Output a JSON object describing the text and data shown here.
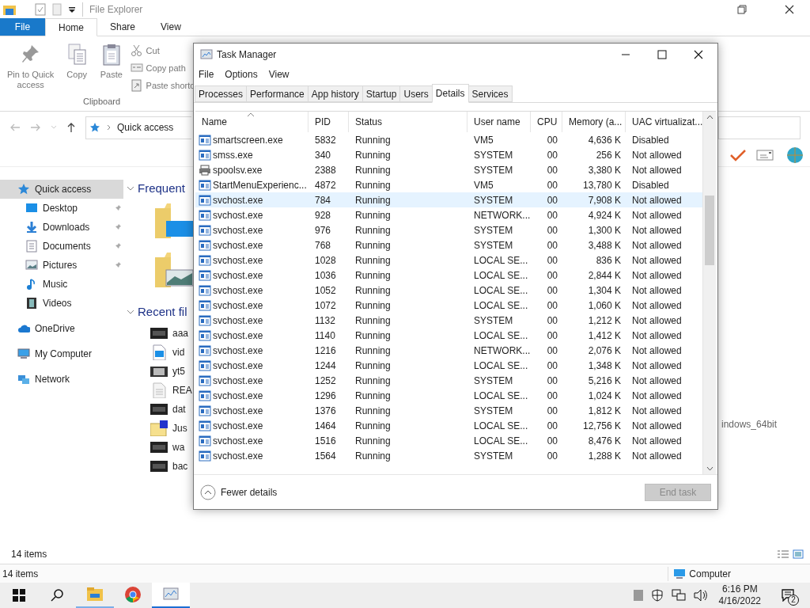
{
  "explorer": {
    "title": "File Explorer",
    "ribbon_tabs": [
      {
        "label": "File",
        "kind": "file",
        "selected": false
      },
      {
        "label": "Home",
        "kind": "tab",
        "selected": true
      },
      {
        "label": "Share",
        "kind": "tab",
        "selected": false
      },
      {
        "label": "View",
        "kind": "tab",
        "selected": false
      }
    ],
    "clipboard": {
      "large_buttons": [
        {
          "label": "Pin to Quick access",
          "kind": "pin"
        },
        {
          "label": "Copy",
          "kind": "copy"
        },
        {
          "label": "Paste",
          "kind": "paste"
        }
      ],
      "small_buttons": [
        {
          "label": "Cut",
          "kind": "cut"
        },
        {
          "label": "Copy path",
          "kind": "path"
        },
        {
          "label": "Paste shortc",
          "kind": "shortcut"
        }
      ],
      "group_label": "Clipboard"
    },
    "address": "Quick access",
    "nav": [
      {
        "label": "Quick access",
        "kind": "star",
        "selected": true,
        "pinned": false,
        "children": [
          {
            "label": "Desktop",
            "kind": "desktop",
            "selected": false,
            "pinned": true
          },
          {
            "label": "Downloads",
            "kind": "download",
            "selected": false,
            "pinned": true
          },
          {
            "label": "Documents",
            "kind": "document",
            "selected": false,
            "pinned": true
          },
          {
            "label": "Pictures",
            "kind": "pictures",
            "selected": false,
            "pinned": true
          },
          {
            "label": "Music",
            "kind": "music",
            "selected": false,
            "pinned": false
          },
          {
            "label": "Videos",
            "kind": "videos",
            "selected": false,
            "pinned": false
          }
        ]
      },
      {
        "label": "OneDrive",
        "kind": "cloud",
        "selected": false,
        "pinned": false
      },
      {
        "label": "My Computer",
        "kind": "computer",
        "selected": false,
        "pinned": false
      },
      {
        "label": "Network",
        "kind": "network",
        "selected": false,
        "pinned": false
      }
    ],
    "frequent": {
      "header": "Frequent",
      "folders": [
        {
          "kind": "desktop"
        },
        {
          "kind": "pictures"
        }
      ]
    },
    "recent": {
      "header": "Recent fil",
      "files": [
        {
          "name": "aaa",
          "kind": "dark"
        },
        {
          "name": "vid",
          "kind": "video"
        },
        {
          "name": "yt5",
          "kind": "film"
        },
        {
          "name": "REA",
          "kind": "text"
        },
        {
          "name": "dat",
          "kind": "dark"
        },
        {
          "name": "Jus",
          "kind": "zip"
        },
        {
          "name": "wa",
          "kind": "dark"
        },
        {
          "name": "bac",
          "kind": "dark"
        }
      ]
    },
    "right_text": "indows_64bit",
    "status_items": "14 items",
    "status_bar": {
      "items": "14 items",
      "location": "Computer"
    }
  },
  "task_manager": {
    "title": "Task Manager",
    "menu": [
      "File",
      "Options",
      "View"
    ],
    "tabs": [
      {
        "label": "Processes",
        "selected": false
      },
      {
        "label": "Performance",
        "selected": false
      },
      {
        "label": "App history",
        "selected": false
      },
      {
        "label": "Startup",
        "selected": false
      },
      {
        "label": "Users",
        "selected": false
      },
      {
        "label": "Details",
        "selected": true
      },
      {
        "label": "Services",
        "selected": false
      }
    ],
    "columns": [
      "Name",
      "PID",
      "Status",
      "User name",
      "CPU",
      "Memory (a...",
      "UAC virtualizat..."
    ],
    "rows": [
      {
        "kind": "app",
        "selected": false,
        "cells": [
          "smartscreen.exe",
          "5832",
          "Running",
          "VM5",
          "00",
          "4,636 K",
          "Disabled"
        ]
      },
      {
        "kind": "app",
        "selected": false,
        "cells": [
          "smss.exe",
          "340",
          "Running",
          "SYSTEM",
          "00",
          "256 K",
          "Not allowed"
        ]
      },
      {
        "kind": "printer",
        "selected": false,
        "cells": [
          "spoolsv.exe",
          "2388",
          "Running",
          "SYSTEM",
          "00",
          "3,380 K",
          "Not allowed"
        ]
      },
      {
        "kind": "app",
        "selected": false,
        "cells": [
          "StartMenuExperienc...",
          "4872",
          "Running",
          "VM5",
          "00",
          "13,780 K",
          "Disabled"
        ]
      },
      {
        "kind": "app",
        "selected": true,
        "cells": [
          "svchost.exe",
          "784",
          "Running",
          "SYSTEM",
          "00",
          "7,908 K",
          "Not allowed"
        ]
      },
      {
        "kind": "app",
        "selected": false,
        "cells": [
          "svchost.exe",
          "928",
          "Running",
          "NETWORK...",
          "00",
          "4,924 K",
          "Not allowed"
        ]
      },
      {
        "kind": "app",
        "selected": false,
        "cells": [
          "svchost.exe",
          "976",
          "Running",
          "SYSTEM",
          "00",
          "1,300 K",
          "Not allowed"
        ]
      },
      {
        "kind": "app",
        "selected": false,
        "cells": [
          "svchost.exe",
          "768",
          "Running",
          "SYSTEM",
          "00",
          "3,488 K",
          "Not allowed"
        ]
      },
      {
        "kind": "app",
        "selected": false,
        "cells": [
          "svchost.exe",
          "1028",
          "Running",
          "LOCAL SE...",
          "00",
          "836 K",
          "Not allowed"
        ]
      },
      {
        "kind": "app",
        "selected": false,
        "cells": [
          "svchost.exe",
          "1036",
          "Running",
          "LOCAL SE...",
          "00",
          "2,844 K",
          "Not allowed"
        ]
      },
      {
        "kind": "app",
        "selected": false,
        "cells": [
          "svchost.exe",
          "1052",
          "Running",
          "LOCAL SE...",
          "00",
          "1,304 K",
          "Not allowed"
        ]
      },
      {
        "kind": "app",
        "selected": false,
        "cells": [
          "svchost.exe",
          "1072",
          "Running",
          "LOCAL SE...",
          "00",
          "1,060 K",
          "Not allowed"
        ]
      },
      {
        "kind": "app",
        "selected": false,
        "cells": [
          "svchost.exe",
          "1132",
          "Running",
          "SYSTEM",
          "00",
          "1,212 K",
          "Not allowed"
        ]
      },
      {
        "kind": "app",
        "selected": false,
        "cells": [
          "svchost.exe",
          "1140",
          "Running",
          "LOCAL SE...",
          "00",
          "1,412 K",
          "Not allowed"
        ]
      },
      {
        "kind": "app",
        "selected": false,
        "cells": [
          "svchost.exe",
          "1216",
          "Running",
          "NETWORK...",
          "00",
          "2,076 K",
          "Not allowed"
        ]
      },
      {
        "kind": "app",
        "selected": false,
        "cells": [
          "svchost.exe",
          "1244",
          "Running",
          "LOCAL SE...",
          "00",
          "1,348 K",
          "Not allowed"
        ]
      },
      {
        "kind": "app",
        "selected": false,
        "cells": [
          "svchost.exe",
          "1252",
          "Running",
          "SYSTEM",
          "00",
          "5,216 K",
          "Not allowed"
        ]
      },
      {
        "kind": "app",
        "selected": false,
        "cells": [
          "svchost.exe",
          "1296",
          "Running",
          "LOCAL SE...",
          "00",
          "1,024 K",
          "Not allowed"
        ]
      },
      {
        "kind": "app",
        "selected": false,
        "cells": [
          "svchost.exe",
          "1376",
          "Running",
          "SYSTEM",
          "00",
          "1,812 K",
          "Not allowed"
        ]
      },
      {
        "kind": "app",
        "selected": false,
        "cells": [
          "svchost.exe",
          "1464",
          "Running",
          "LOCAL SE...",
          "00",
          "12,756 K",
          "Not allowed"
        ]
      },
      {
        "kind": "app",
        "selected": false,
        "cells": [
          "svchost.exe",
          "1516",
          "Running",
          "LOCAL SE...",
          "00",
          "8,476 K",
          "Not allowed"
        ]
      },
      {
        "kind": "app",
        "selected": false,
        "cells": [
          "svchost.exe",
          "1564",
          "Running",
          "SYSTEM",
          "00",
          "1,288 K",
          "Not allowed"
        ]
      }
    ],
    "footer": {
      "fewer_details": "Fewer details",
      "end_task": {
        "label": "End task",
        "disabled": true
      }
    }
  },
  "taskbar": {
    "apps": [
      {
        "kind": "explorer",
        "running": true,
        "active": false
      },
      {
        "kind": "chrome",
        "running": false,
        "active": false
      },
      {
        "kind": "taskmgr",
        "running": true,
        "active": true
      }
    ],
    "time": "6:16 PM",
    "date": "4/16/2022",
    "notifications": "2"
  }
}
